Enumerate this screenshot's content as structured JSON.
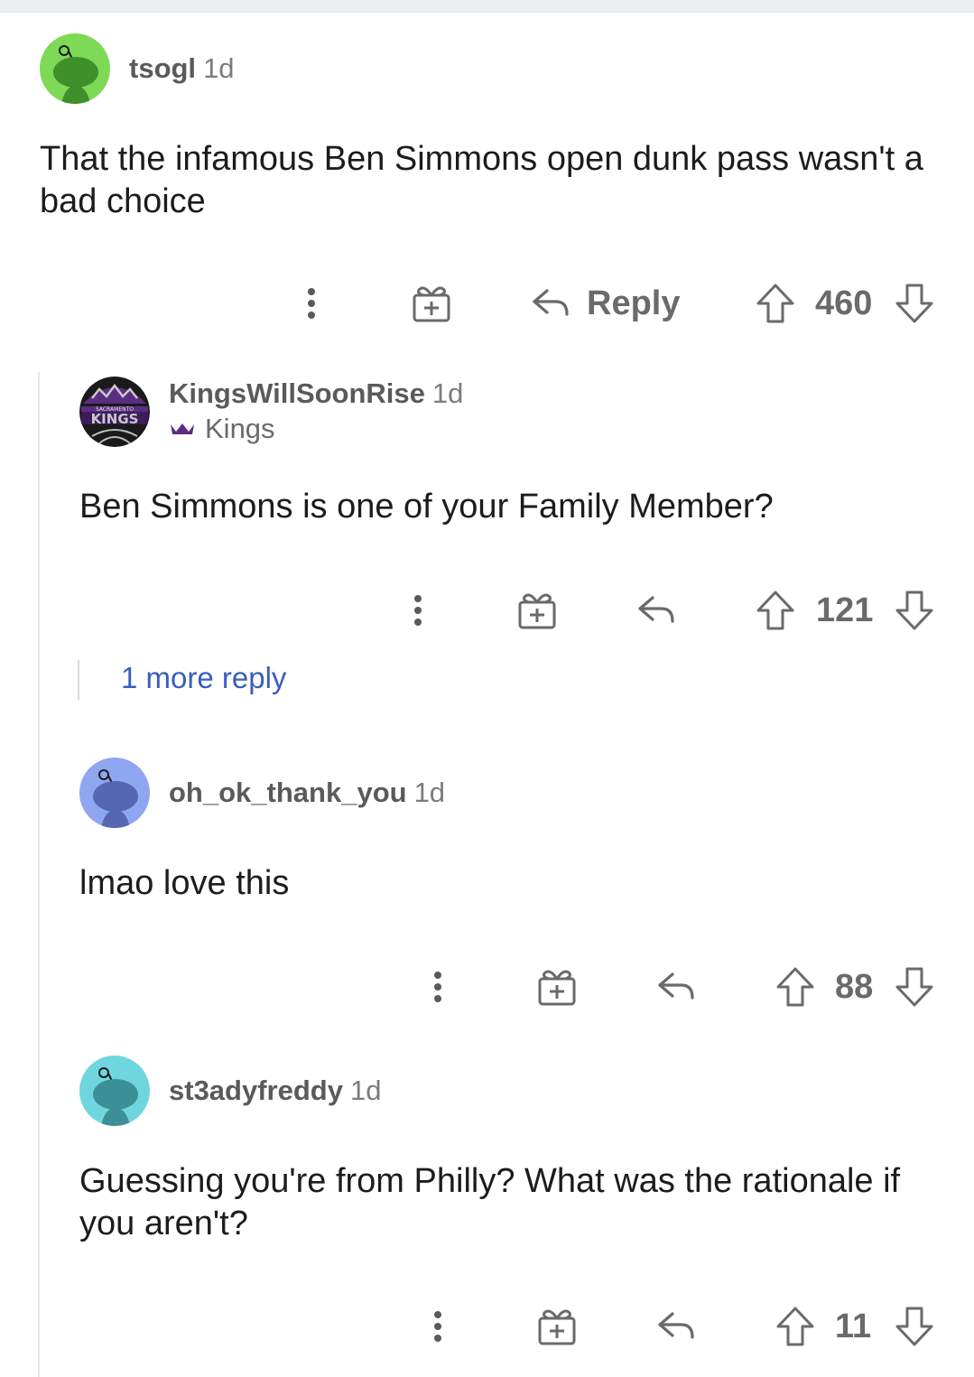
{
  "comments": [
    {
      "username": "tsogl",
      "time": "1d",
      "body": "That the infamous Ben Simmons open dunk pass wasn't a bad choice",
      "reply_label": "Reply",
      "score": "460",
      "avatar_color": "#7ed957"
    },
    {
      "username": "KingsWillSoonRise",
      "time": "1d",
      "flair": "Kings",
      "avatar_text_top": "SACRAMENTO",
      "avatar_text_main": "KINGS",
      "body": "Ben Simmons is one of your Family Member?",
      "score": "121",
      "more_replies": "1 more reply",
      "avatar_color": "#5a2d82"
    },
    {
      "username": "oh_ok_thank_you",
      "time": "1d",
      "body": "lmao love this",
      "score": "88",
      "avatar_color": "#8fa6f0"
    },
    {
      "username": "st3adyfreddy",
      "time": "1d",
      "body": "Guessing you're from Philly? What was the rationale if you aren't?",
      "score": "11",
      "avatar_color": "#6fd6df"
    }
  ],
  "icons": [
    "more-options-icon",
    "award-icon",
    "reply-icon",
    "upvote-icon",
    "downvote-icon",
    "crown-icon"
  ],
  "colors": {
    "link": "#3a5ebd",
    "meta": "#7c7c7c",
    "icon": "#6a6a6a"
  }
}
